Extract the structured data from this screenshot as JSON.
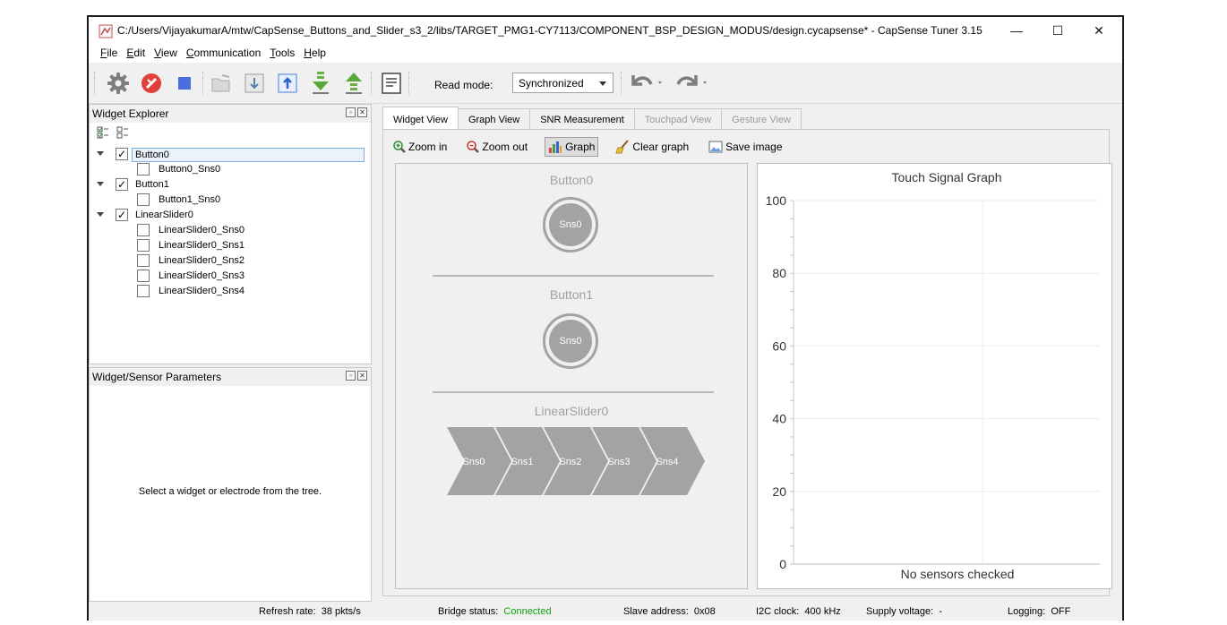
{
  "window": {
    "title": "C:/Users/VijayakumarA/mtw/CapSense_Buttons_and_Slider_s3_2/libs/TARGET_PMG1-CY7113/COMPONENT_BSP_DESIGN_MODUS/design.cycapsense* - CapSense Tuner 3.15",
    "minimize_glyph": "—",
    "maximize_glyph": "☐",
    "close_glyph": "✕"
  },
  "menu": [
    {
      "ul": "F",
      "rest": "ile"
    },
    {
      "ul": "E",
      "rest": "dit"
    },
    {
      "ul": "V",
      "rest": "iew"
    },
    {
      "ul": "C",
      "rest": "ommunication"
    },
    {
      "ul": "T",
      "rest": "ools"
    },
    {
      "ul": "H",
      "rest": "elp"
    }
  ],
  "toolbar": {
    "read_mode_label": "Read mode:",
    "read_mode_value": "Synchronized",
    "icons": [
      "gear-icon",
      "disconnect-icon",
      "stop-icon",
      "open-folder-icon",
      "read-icon",
      "write-icon",
      "import-icon",
      "export-icon",
      "log-icon",
      "undo-icon",
      "redo-icon"
    ]
  },
  "widget_explorer": {
    "title": "Widget Explorer",
    "tree": [
      {
        "label": "Button0",
        "checked": true,
        "children": [
          "Button0_Sns0"
        ]
      },
      {
        "label": "Button1",
        "checked": true,
        "children": [
          "Button1_Sns0"
        ]
      },
      {
        "label": "LinearSlider0",
        "checked": true,
        "children": [
          "LinearSlider0_Sns0",
          "LinearSlider0_Sns1",
          "LinearSlider0_Sns2",
          "LinearSlider0_Sns3",
          "LinearSlider0_Sns4"
        ]
      }
    ],
    "selected": "Button0"
  },
  "params_panel": {
    "title": "Widget/Sensor Parameters",
    "hint": "Select a widget or electrode from the tree."
  },
  "tabs": [
    {
      "label": "Widget View",
      "state": "active"
    },
    {
      "label": "Graph View",
      "state": "normal"
    },
    {
      "label": "SNR Measurement",
      "state": "normal"
    },
    {
      "label": "Touchpad View",
      "state": "disabled"
    },
    {
      "label": "Gesture View",
      "state": "disabled"
    }
  ],
  "subtoolbar": {
    "zoom_in": "Zoom in",
    "zoom_out": "Zoom out",
    "graph": "Graph",
    "clear_graph": "Clear graph",
    "save_image": "Save image"
  },
  "widget_view": {
    "button0_title": "Button0",
    "button0_sensor": "Sns0",
    "button1_title": "Button1",
    "button1_sensor": "Sns0",
    "slider_title": "LinearSlider0",
    "slider_segments": [
      "Sns0",
      "Sns1",
      "Sns2",
      "Sns3",
      "Sns4"
    ],
    "segment_color": "#a3a3a3"
  },
  "chart_data": {
    "type": "line",
    "title": "Touch Signal Graph",
    "ylim": [
      0,
      100
    ],
    "yticks": [
      0,
      20,
      40,
      60,
      80,
      100
    ],
    "series": [],
    "annotation": "No sensors checked",
    "grid": true
  },
  "status": {
    "refresh_label": "Refresh rate:",
    "refresh_value": "38 pkts/s",
    "bridge_label": "Bridge status:",
    "bridge_value": "Connected",
    "bridge_color": "#11a011",
    "slave_label": "Slave address:",
    "slave_value": "0x08",
    "i2c_label": "I2C clock:",
    "i2c_value": "400 kHz",
    "supply_label": "Supply voltage:",
    "supply_value": "-",
    "logging_label": "Logging:",
    "logging_value": "OFF"
  }
}
